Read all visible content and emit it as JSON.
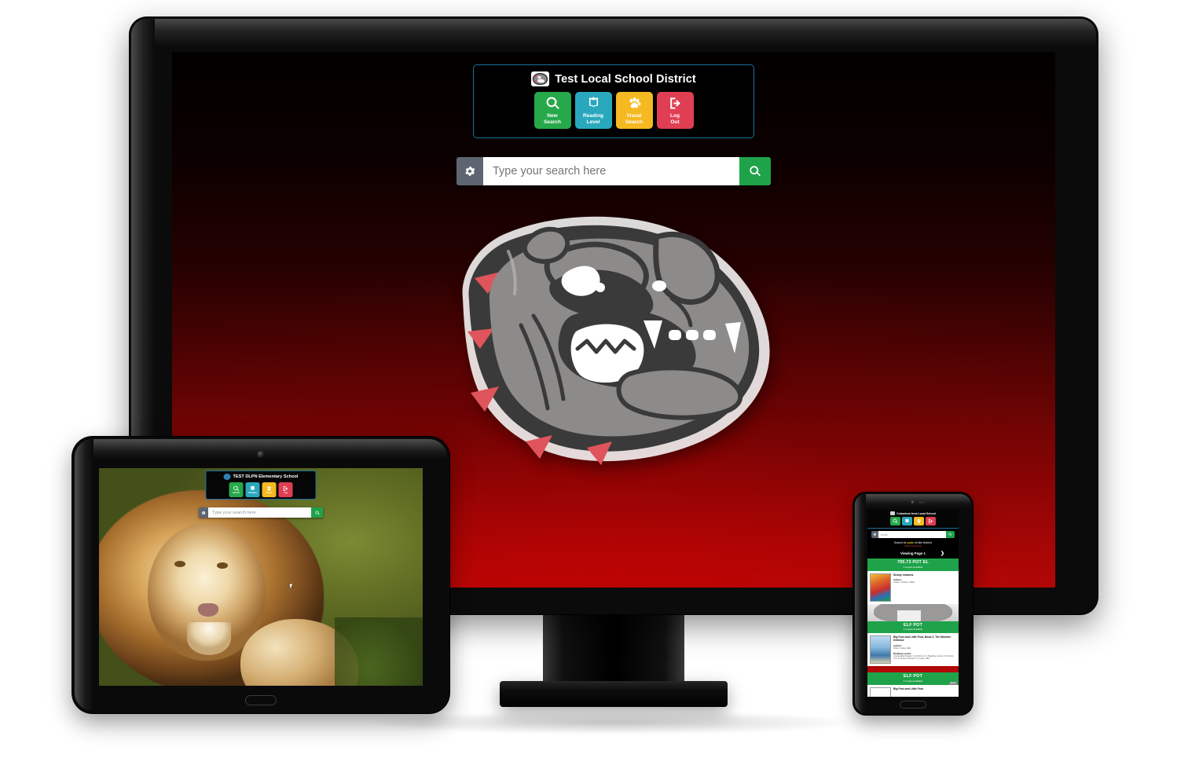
{
  "desktop": {
    "header": {
      "logo_icon": "bulldog-logo-icon",
      "title": "Test Local School District",
      "buttons": [
        {
          "label_line1": "New",
          "label_line2": "Search",
          "color": "#27a84a",
          "icon": "magnifier-icon"
        },
        {
          "label_line1": "Reading",
          "label_line2": "Level",
          "color": "#29a8bd",
          "icon": "open-book-icon"
        },
        {
          "label_line1": "Visual",
          "label_line2": "Search",
          "color": "#f5b921",
          "icon": "paw-print-icon"
        },
        {
          "label_line1": "Log",
          "label_line2": "Out",
          "color": "#e03e52",
          "icon": "logout-icon"
        }
      ]
    },
    "search": {
      "placeholder": "Type your search here",
      "value": "",
      "gear_icon": "gear-icon",
      "submit_icon": "search-icon"
    },
    "wallpaper": "bulldog-mascot-maroon-gradient"
  },
  "tablet": {
    "header": {
      "title": "TEST DLPN Elementary School",
      "buttons": [
        {
          "label_line1": "New",
          "label_line2": "Search",
          "color": "#27a84a"
        },
        {
          "label_line1": "Reading",
          "label_line2": "Level",
          "color": "#29a8bd"
        },
        {
          "label_line1": "Visual",
          "label_line2": "Search",
          "color": "#f5b921"
        },
        {
          "label_line1": "Log",
          "label_line2": "Out",
          "color": "#e03e52"
        }
      ]
    },
    "search": {
      "placeholder": "Type your search here",
      "value": ""
    },
    "wallpaper": "lion-photograph"
  },
  "phone": {
    "header": {
      "title": "Columbus Area Local School",
      "buttons": [
        {
          "label": "New Search",
          "color": "#27a84a"
        },
        {
          "label": "Reading Level",
          "color": "#29a8bd"
        },
        {
          "label": "Visual Search",
          "color": "#f5b921"
        },
        {
          "label": "Log Out",
          "color": "#e03e52"
        }
      ]
    },
    "search": {
      "value": "polar",
      "placeholder": "Type your search here"
    },
    "status": {
      "prefix": "Search for",
      "term": "polar",
      "suffix": "44 title fetched",
      "secondary": "Showing Results"
    },
    "pager": {
      "label": "Viewing Page 1",
      "next_icon": "chevron-right-icon"
    },
    "results": [
      {
        "shelf": "795.73 POT EL",
        "availability": "1 Copies Available",
        "title": "Snowy seasons",
        "author_label": "Author:",
        "author_value": "Coben / Gibson / Miller"
      },
      {
        "shelf": "ELF POT",
        "availability": "1 Copies Available",
        "title": "Big Foot and Little Foot, Book 2, The Monster Detector",
        "author_label": "Author:",
        "author_value": "Potter / Hale / Ellis",
        "reading_label": "Reading Levels:",
        "reading_value": "Accelerated Reader: 4.2 Points 1.0 | Reading Counts: 3.6 Points 3.0 | Fountas & Pinnell: O | Lexile: 680"
      },
      {
        "shelf": "ELF POT",
        "availability": "1 Copies Available",
        "title": "Big Foot and Little Foot",
        "badge": "Ebook"
      }
    ]
  }
}
